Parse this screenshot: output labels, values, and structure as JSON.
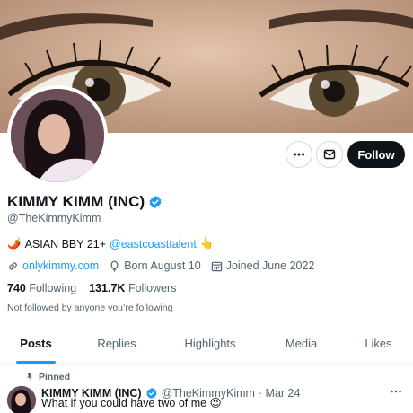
{
  "profile": {
    "display_name": "KIMMY KIMM (INC)",
    "handle": "@TheKimmyKimm",
    "bio_text": "ASIAN BBY 21+",
    "bio_mention": "@eastcoasttalent",
    "bio_emoji_start": "🌶️",
    "bio_emoji_end": "👆",
    "website": "onlykimmy.com",
    "birthday": "Born August 10",
    "joined": "Joined June 2022",
    "following_count": "740",
    "following_label": "Following",
    "followers_count": "131.7K",
    "followers_label": "Followers",
    "followed_note": "Not followed by anyone you’re following"
  },
  "actions": {
    "more_icon": "more-icon",
    "mail_icon": "mail-icon",
    "follow_label": "Follow"
  },
  "tabs": [
    {
      "label": "Posts"
    },
    {
      "label": "Replies"
    },
    {
      "label": "Highlights"
    },
    {
      "label": "Media"
    },
    {
      "label": "Likes"
    }
  ],
  "pinned_tweet": {
    "pinned_label": "Pinned",
    "author_name": "KIMMY KIMM (INC)",
    "author_handle": "@TheKimmyKimm",
    "date": "· Mar 24",
    "text": "What if you could have two of me 😉"
  },
  "colors": {
    "accent": "#1d9bf0",
    "text_primary": "#0f1419",
    "text_secondary": "#536471"
  }
}
